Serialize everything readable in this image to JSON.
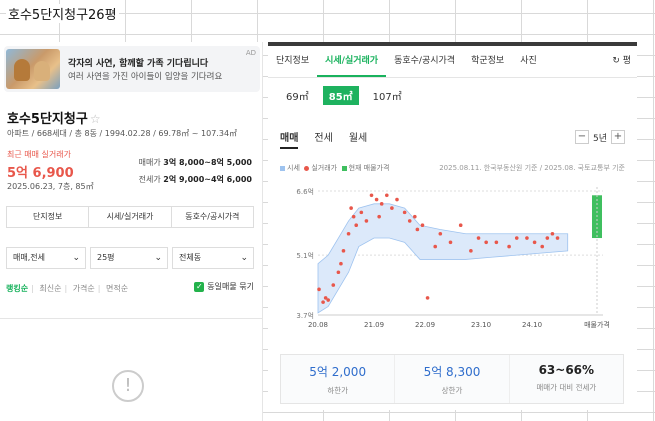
{
  "sheet": {
    "title": "호수5단지청구26평"
  },
  "ad": {
    "title": "각자의 사연, 함께할 가족 기다립니다",
    "subtitle": "여러 사연을 가진 아이들이 입양을 기다려요",
    "badge": "AD"
  },
  "apartment": {
    "name": "호수5단지청구",
    "star": "☆",
    "info": "아파트 / 668세대 / 총 8동 / 1994.02.28 / 69.78㎡ ~ 107.34㎡",
    "recent_label": "최근 매매 실거래가",
    "recent_price": "5억 6,900",
    "recent_date": "2025.06.23, 7층, 85㎡",
    "sale_label": "매매가",
    "sale_range": "3억 8,000~8억 5,000",
    "jeonse_label": "전세가",
    "jeonse_range": "2억 9,000~4억 6,000"
  },
  "left_buttons": [
    "단지정보",
    "시세/실거래가",
    "동호수/공시가격"
  ],
  "filters": {
    "type": "매매,전세",
    "size": "25평",
    "dong": "전체동"
  },
  "sort": {
    "items": [
      "랭킹순",
      "최신순",
      "가격순",
      "면적순"
    ],
    "checkbox_label": "동일매물 묶기"
  },
  "right_tabs": [
    "단지정보",
    "시세/실거래가",
    "동호수/공시가격",
    "학군정보",
    "사진"
  ],
  "right_tab_extra": "↻ 평",
  "sizes": [
    "69㎡",
    "85㎡",
    "107㎡"
  ],
  "mode_tabs": [
    "매매",
    "전세",
    "월세"
  ],
  "period": {
    "minus": "−",
    "label": "5년",
    "plus": "+"
  },
  "legend": [
    "시세",
    "실거래가",
    "현재 매물가격"
  ],
  "source_note": "2025.08.11. 한국부동산원 기준 / 2025.08. 국토교통부 기준",
  "colors": {
    "accent": "#19b25d",
    "blue": "#2f6dcc",
    "red": "#e8574b",
    "band": "#cfe0f7"
  },
  "chart_data": {
    "type": "scatter",
    "ylabels": [
      "6.6억",
      "5.1억",
      "3.7억"
    ],
    "yticks": [
      6.6,
      5.1,
      3.7
    ],
    "xlabels": [
      "20.08",
      "21.09",
      "22.09",
      "23.10",
      "24.10",
      "매물가격"
    ],
    "xticks": [
      2020.6,
      2021.7,
      2022.7,
      2023.8,
      2024.8
    ],
    "xlim": [
      2020.6,
      2025.8
    ],
    "ylim": [
      3.7,
      6.6
    ],
    "band_upper": [
      [
        2020.6,
        4.9
      ],
      [
        2020.8,
        5.1
      ],
      [
        2021.0,
        5.5
      ],
      [
        2021.2,
        5.9
      ],
      [
        2021.4,
        6.2
      ],
      [
        2021.7,
        6.3
      ],
      [
        2022.0,
        6.3
      ],
      [
        2022.3,
        6.2
      ],
      [
        2022.6,
        5.8
      ],
      [
        2023.0,
        5.7
      ],
      [
        2023.5,
        5.6
      ],
      [
        2024.0,
        5.6
      ],
      [
        2024.5,
        5.6
      ],
      [
        2025.0,
        5.6
      ],
      [
        2025.5,
        5.6
      ]
    ],
    "band_lower": [
      [
        2020.6,
        3.75
      ],
      [
        2020.8,
        3.9
      ],
      [
        2021.0,
        4.3
      ],
      [
        2021.2,
        4.7
      ],
      [
        2021.4,
        5.3
      ],
      [
        2021.7,
        5.5
      ],
      [
        2022.0,
        5.5
      ],
      [
        2022.3,
        5.4
      ],
      [
        2022.6,
        5.0
      ],
      [
        2023.0,
        5.0
      ],
      [
        2023.5,
        5.0
      ],
      [
        2024.0,
        5.05
      ],
      [
        2024.5,
        5.1
      ],
      [
        2025.0,
        5.15
      ],
      [
        2025.5,
        5.2
      ]
    ],
    "points": [
      [
        2020.62,
        4.3
      ],
      [
        2020.7,
        4.0
      ],
      [
        2020.75,
        4.1
      ],
      [
        2020.8,
        4.05
      ],
      [
        2020.9,
        4.4
      ],
      [
        2021.0,
        4.7
      ],
      [
        2021.05,
        4.9
      ],
      [
        2021.1,
        5.2
      ],
      [
        2021.2,
        5.6
      ],
      [
        2021.25,
        6.2
      ],
      [
        2021.3,
        6.0
      ],
      [
        2021.35,
        5.8
      ],
      [
        2021.45,
        6.1
      ],
      [
        2021.55,
        5.9
      ],
      [
        2021.65,
        6.5
      ],
      [
        2021.75,
        6.4
      ],
      [
        2021.8,
        6.0
      ],
      [
        2021.85,
        6.3
      ],
      [
        2021.95,
        6.5
      ],
      [
        2022.05,
        6.2
      ],
      [
        2022.15,
        6.4
      ],
      [
        2022.3,
        6.1
      ],
      [
        2022.4,
        5.9
      ],
      [
        2022.5,
        6.0
      ],
      [
        2022.55,
        5.7
      ],
      [
        2022.65,
        5.8
      ],
      [
        2022.75,
        4.1
      ],
      [
        2022.9,
        5.3
      ],
      [
        2023.0,
        5.6
      ],
      [
        2023.2,
        5.4
      ],
      [
        2023.4,
        5.8
      ],
      [
        2023.6,
        5.2
      ],
      [
        2023.75,
        5.5
      ],
      [
        2023.9,
        5.4
      ],
      [
        2024.1,
        5.4
      ],
      [
        2024.35,
        5.3
      ],
      [
        2024.5,
        5.5
      ],
      [
        2024.7,
        5.5
      ],
      [
        2024.85,
        5.4
      ],
      [
        2025.0,
        5.3
      ],
      [
        2025.1,
        5.5
      ],
      [
        2025.2,
        5.6
      ],
      [
        2025.3,
        5.5
      ]
    ],
    "listing_range": [
      5.5,
      6.5
    ]
  },
  "summary": [
    {
      "value": "5억 2,000",
      "label": "하한가"
    },
    {
      "value": "5억 8,300",
      "label": "상한가"
    },
    {
      "value": "63~66%",
      "label": "매매가 대비 전세가"
    }
  ]
}
